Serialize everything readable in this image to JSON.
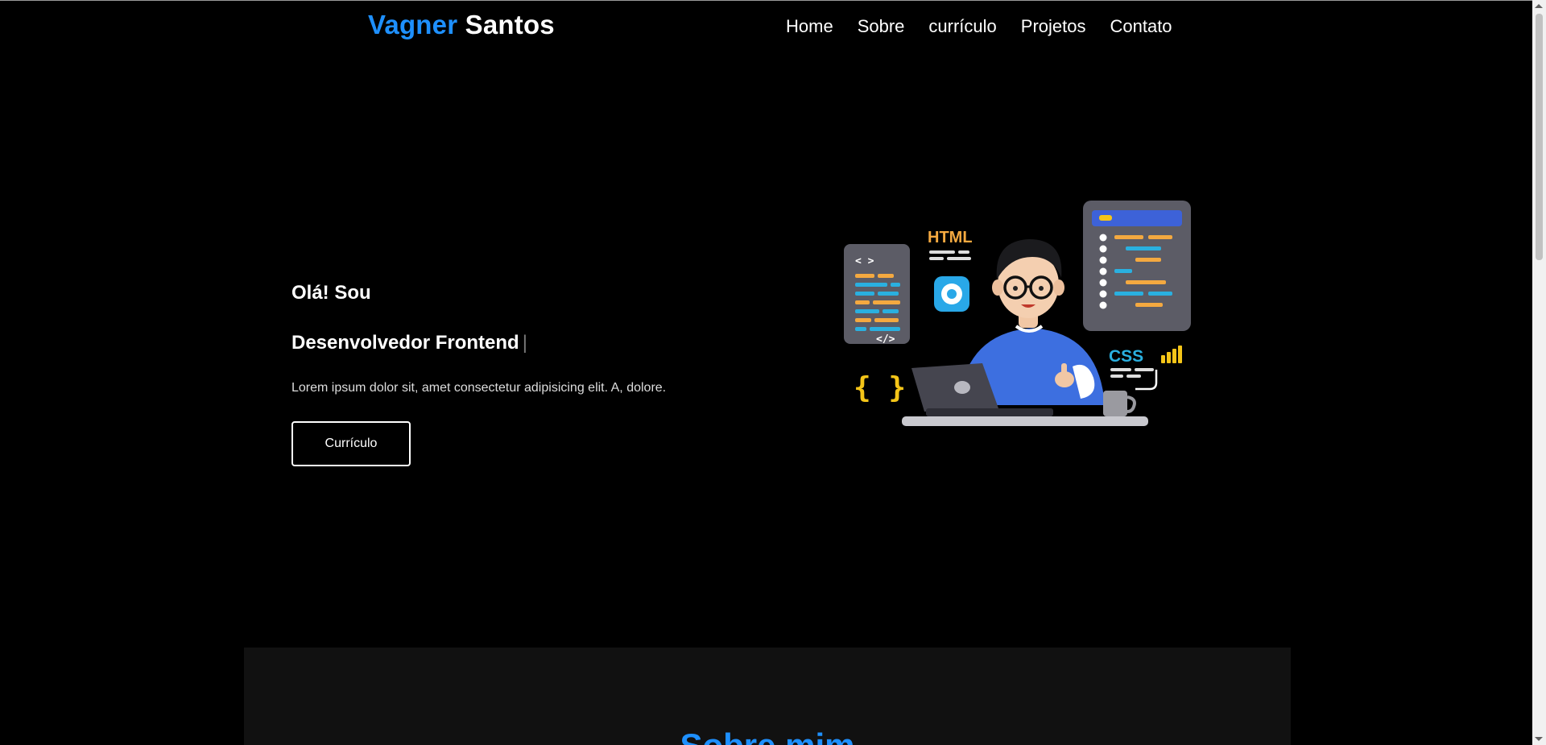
{
  "header": {
    "logo_first": "Vagner",
    "logo_last": "Santos",
    "nav": [
      "Home",
      "Sobre",
      "currículo",
      "Projetos",
      "Contato"
    ]
  },
  "hero": {
    "greeting": "Olá! Sou",
    "role": "Desenvolvedor Frontend",
    "cursor": "|",
    "description": "Lorem ipsum dolor sit, amet consectetur adipisicing elit. A, dolore.",
    "button_label": "Currículo"
  },
  "illustration": {
    "html_label": "HTML",
    "css_label": "CSS",
    "braces": "{ }",
    "code_open": "< >",
    "code_close": "</>"
  },
  "about": {
    "title": "Sobre mim"
  },
  "colors": {
    "accent": "#1e90ff",
    "background": "#000000",
    "section_bg": "#111111"
  }
}
